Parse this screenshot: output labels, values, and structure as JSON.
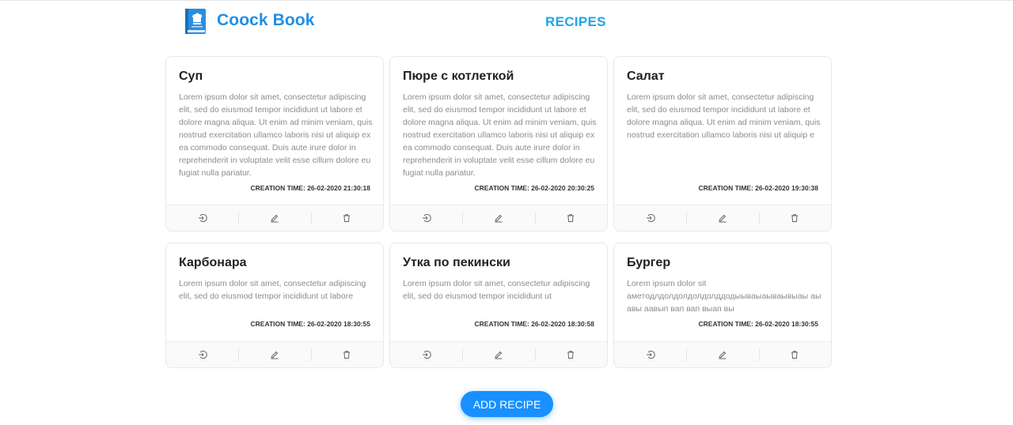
{
  "header": {
    "brand": "Coock Book",
    "nav_recipes": "RECIPES"
  },
  "icons": {
    "logo": "cookbook-icon",
    "open": "login-icon",
    "edit": "edit-icon",
    "delete": "delete-icon"
  },
  "colors": {
    "brand": "#1e8fe8",
    "nav": "#1ea6e3",
    "primary_button": "#1890ff"
  },
  "recipes": [
    {
      "title": "Суп",
      "description": "Lorem ipsum dolor sit amet, consectetur adipiscing elit, sed do eiusmod tempor incididunt ut labore et dolore magna aliqua. Ut enim ad minim veniam, quis nostrud exercitation ullamco laboris nisi ut aliquip ex ea commodo consequat. Duis aute irure dolor in reprehenderit in voluptate velit esse cillum dolore eu fugiat nulla pariatur.",
      "creation_time": "CREATION TIME: 26-02-2020 21:30:18"
    },
    {
      "title": "Пюре с котлеткой",
      "description": "Lorem ipsum dolor sit amet, consectetur adipiscing elit, sed do eiusmod tempor incididunt ut labore et dolore magna aliqua. Ut enim ad minim veniam, quis nostrud exercitation ullamco laboris nisi ut aliquip ex ea commodo consequat. Duis aute irure dolor in reprehenderit in voluptate velit esse cillum dolore eu fugiat nulla pariatur.",
      "creation_time": "CREATION TIME: 26-02-2020 20:30:25"
    },
    {
      "title": "Салат",
      "description": "Lorem ipsum dolor sit amet, consectetur adipiscing elit, sed do eiusmod tempor incididunt ut labore et dolore magna aliqua. Ut enim ad minim veniam, quis nostrud exercitation ullamco laboris nisi ut aliquip e",
      "creation_time": "CREATION TIME: 26-02-2020 19:30:38"
    },
    {
      "title": "Карбонара",
      "description": "Lorem ipsum dolor sit amet, consectetur adipiscing elit, sed do eiusmod tempor incididunt ut labore",
      "creation_time": "CREATION TIME: 26-02-2020 18:30:55"
    },
    {
      "title": "Утка по пекински",
      "description": "Lorem ipsum dolor sit amet, consectetur adipiscing elit, sed do eiusmod tempor incididunt ut",
      "creation_time": "CREATION TIME: 26-02-2020 18:30:58"
    },
    {
      "title": "Бургер",
      "description": "Lorem ipsum dolor sit аметодлдолдолдолдолддодыываыаываывыаы аы авы аавып вап вап выап вы",
      "creation_time": "CREATION TIME: 26-02-2020 18:30:55"
    }
  ],
  "add_button": "ADD RECIPE"
}
